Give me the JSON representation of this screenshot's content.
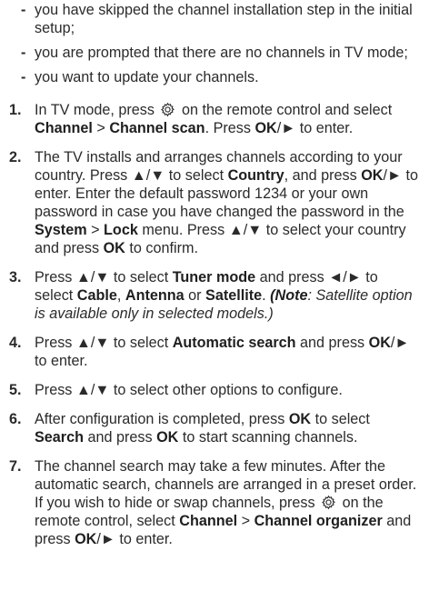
{
  "bullets": [
    "you have skipped the channel installation step in the initial setup;",
    "you are prompted that there are no channels in TV mode;",
    "you want to update your channels."
  ],
  "steps": [
    {
      "number": "1.",
      "parts": [
        {
          "t": "In TV mode, press "
        },
        {
          "icon": "settings-gear-icon"
        },
        {
          "t": " on the remote control and select "
        },
        {
          "b": "Channel"
        },
        {
          "t": " > "
        },
        {
          "b": "Channel scan"
        },
        {
          "t": ". Press "
        },
        {
          "b": "OK"
        },
        {
          "t": "/► to enter."
        }
      ]
    },
    {
      "number": "2.",
      "parts": [
        {
          "t": "The TV installs and arranges channels according to your country. Press ▲/▼ to select "
        },
        {
          "b": "Country"
        },
        {
          "t": ", and press "
        },
        {
          "b": "OK"
        },
        {
          "t": "/► to enter. Enter the default password 1234 or your own password in case you have changed the password in the "
        },
        {
          "b": "System"
        },
        {
          "t": " > "
        },
        {
          "b": "Lock"
        },
        {
          "t": " menu. Press ▲/▼ to select your country and press "
        },
        {
          "b": "OK"
        },
        {
          "t": " to confirm."
        }
      ]
    },
    {
      "number": "3.",
      "parts": [
        {
          "t": "Press ▲/▼ to select "
        },
        {
          "b": "Tuner mode"
        },
        {
          "t": " and press ◄/► to select "
        },
        {
          "b": "Cable"
        },
        {
          "t": ", "
        },
        {
          "b": "Antenna"
        },
        {
          "t": " or "
        },
        {
          "b": "Satellite"
        },
        {
          "t": ". "
        },
        {
          "ib": "(Note"
        },
        {
          "i": ": Satellite option is available only in selected models.)"
        }
      ]
    },
    {
      "number": "4.",
      "parts": [
        {
          "t": "Press ▲/▼ to select "
        },
        {
          "b": "Automatic search"
        },
        {
          "t": " and press "
        },
        {
          "b": "OK"
        },
        {
          "t": "/► to enter."
        }
      ]
    },
    {
      "number": "5.",
      "parts": [
        {
          "t": "Press ▲/▼ to select other options to configure."
        }
      ]
    },
    {
      "number": "6.",
      "parts": [
        {
          "t": "After configuration is completed, press "
        },
        {
          "b": "OK"
        },
        {
          "t": " to select "
        },
        {
          "b": "Search"
        },
        {
          "t": " and press "
        },
        {
          "b": "OK"
        },
        {
          "t": " to start scanning channels."
        }
      ]
    },
    {
      "number": "7.",
      "parts": [
        {
          "t": "The channel search may take a few minutes. After the automatic search, channels are arranged in a preset order. If you wish to hide or swap channels, press "
        },
        {
          "icon": "settings-gear-icon"
        },
        {
          "t": " on the remote control, select "
        },
        {
          "b": "Channel"
        },
        {
          "t": " > "
        },
        {
          "b": "Channel organizer"
        },
        {
          "t": " and press "
        },
        {
          "b": "OK"
        },
        {
          "t": "/► to enter."
        }
      ]
    }
  ]
}
